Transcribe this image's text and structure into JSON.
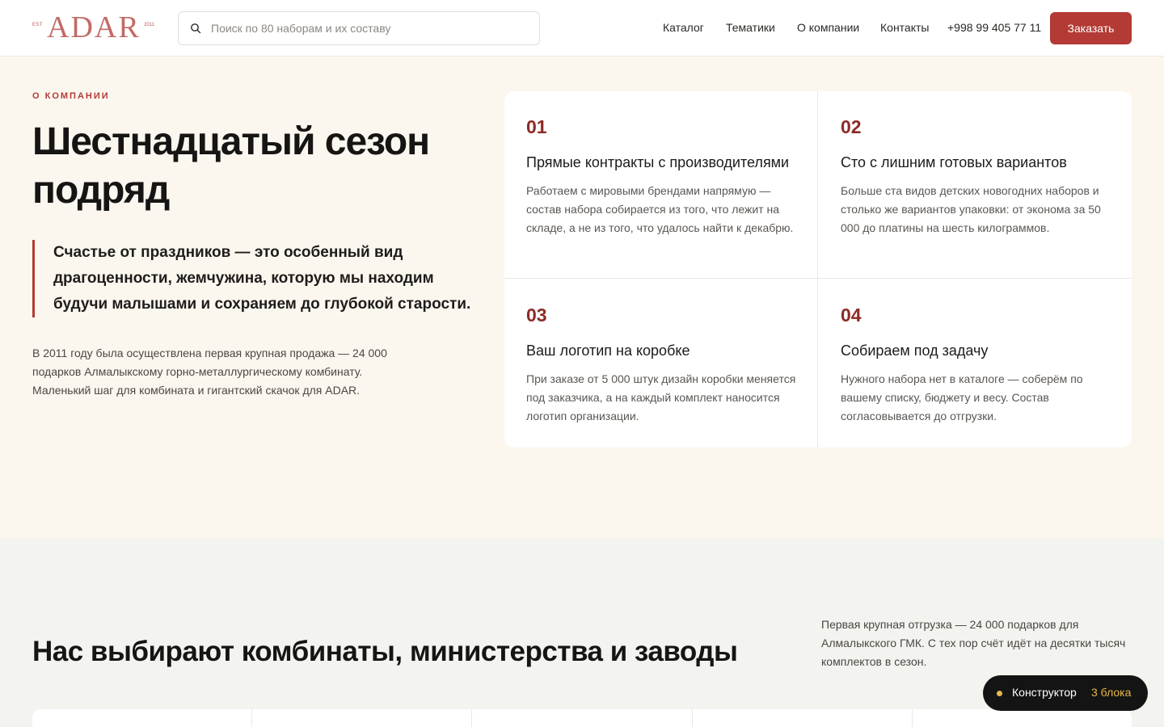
{
  "header": {
    "logo": {
      "est": "EST",
      "word": "ADAR",
      "year": "2011"
    },
    "search_placeholder": "Поиск по 80 наборам и их составу",
    "nav": [
      "Каталог",
      "Тематики",
      "О компании",
      "Контакты"
    ],
    "phone": "+998 99 405 77 11",
    "order_label": "Заказать"
  },
  "about": {
    "eyebrow": "О КОМПАНИИ",
    "title": "Шестнадцатый сезон подряд",
    "quote": "Счастье от праздников — это особенный вид драгоценности, жемчужина, которую мы находим будучи малышами и сохраняем до глубокой старости.",
    "paragraph": "В 2011 году была осуществлена первая крупная продажа — 24 000 подарков Алмалыкскому горно-металлургическому комбинату. Маленький шаг для комбината и гигантский скачок для ADAR.",
    "features": [
      {
        "num": "01",
        "title": "Прямые контракты с производителями",
        "desc": "Работаем с мировыми брендами напрямую — состав набора собирается из того, что лежит на складе, а не из того, что удалось найти к декабрю."
      },
      {
        "num": "02",
        "title": "Сто с лишним готовых вариантов",
        "desc": "Больше ста видов детских новогодних наборов и столько же вариантов упаковки: от эконома за 50 000 до платины на шесть килограммов."
      },
      {
        "num": "03",
        "title": "Ваш логотип на коробке",
        "desc": "При заказе от 5 000 штук дизайн коробки меняется под заказчика, а на каждый комплект наносится логотип организации."
      },
      {
        "num": "04",
        "title": "Собираем под задачу",
        "desc": "Нужного набора нет в каталоге — соберём по вашему списку, бюджету и весу. Состав согласовывается до отгрузки."
      }
    ]
  },
  "clients": {
    "title": "Нас выбирают комбинаты, министерства и заводы",
    "note": "Первая крупная отгрузка — 24 000 подарков для Алмалыкского ГМК. С тех пор счёт идёт на десятки тысяч комплектов в сезон."
  },
  "constructor": {
    "label": "Конструктор",
    "count": "3 блока"
  },
  "colors": {
    "accent": "#b33a35",
    "number": "#8d2a26",
    "cream": "#fbf7ef",
    "gold": "#e8b84a"
  },
  "icons": {
    "search": "search-icon",
    "constructor_dot": "status-dot-icon"
  }
}
